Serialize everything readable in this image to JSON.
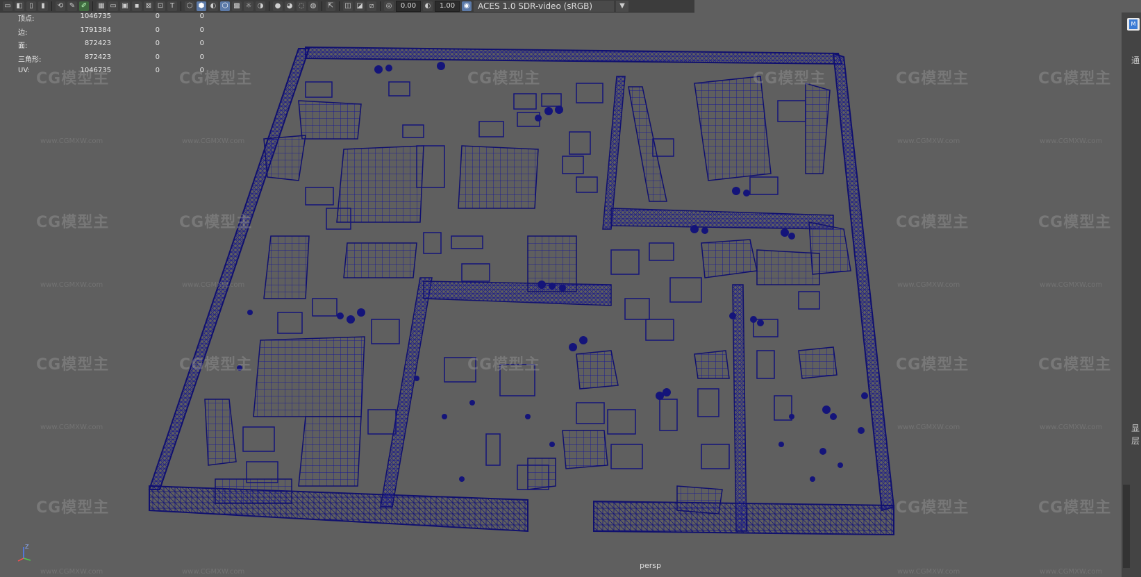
{
  "toolbar": {
    "exposure_value": "0.00",
    "gamma_value": "1.00",
    "color_management": "ACES 1.0 SDR-video (sRGB)"
  },
  "hud": {
    "rows": [
      {
        "label": "顶点:",
        "value": "1046735",
        "selected": "0",
        "triangles": "0"
      },
      {
        "label": "边:",
        "value": "1791384",
        "selected": "0",
        "triangles": "0"
      },
      {
        "label": "面:",
        "value": "872423",
        "selected": "0",
        "triangles": "0"
      },
      {
        "label": "三角形:",
        "value": "872423",
        "selected": "0",
        "triangles": "0"
      },
      {
        "label": "UV:",
        "value": "1046735",
        "selected": "0",
        "triangles": "0"
      }
    ]
  },
  "viewport": {
    "camera_label": "persp",
    "axis_label": "Z"
  },
  "side_panel": {
    "text_1": "通",
    "text_2": "显",
    "text_3": "层"
  },
  "watermark": {
    "logo_text": "CG模型主",
    "url_text": "www.CGMXW.com"
  },
  "colors": {
    "wireframe": "#1a1a8c",
    "background": "#5f5f5f",
    "toolbar": "#3c3c3c"
  }
}
